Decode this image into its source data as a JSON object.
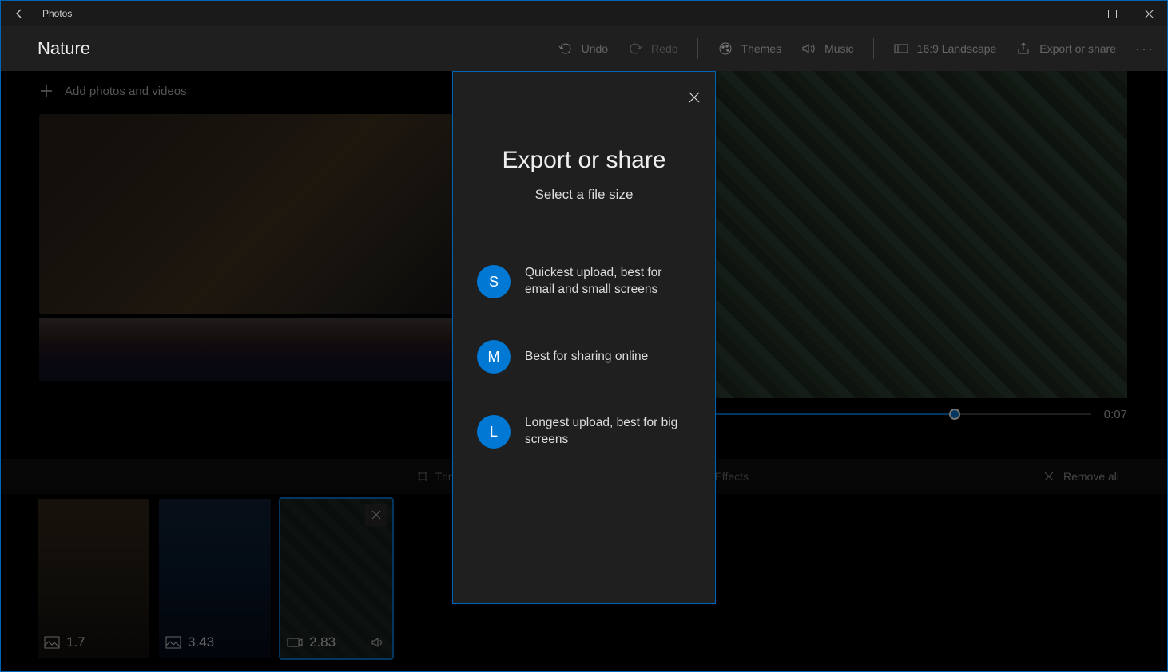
{
  "app": {
    "name": "Photos"
  },
  "project": {
    "title": "Nature"
  },
  "toolbar": {
    "undo": "Undo",
    "redo": "Redo",
    "themes": "Themes",
    "music": "Music",
    "aspect": "16:9 Landscape",
    "export": "Export or share"
  },
  "library": {
    "add_label": "Add photos and videos"
  },
  "preview": {
    "timecode": "0:07",
    "progress_pct": 75
  },
  "storyboard": {
    "trim": "Trim",
    "effects": "Effects",
    "remove_all": "Remove all"
  },
  "clips": [
    {
      "duration": "1.7",
      "type": "image"
    },
    {
      "duration": "3.43",
      "type": "image"
    },
    {
      "duration": "2.83",
      "type": "video",
      "selected": true,
      "has_audio": true
    }
  ],
  "dialog": {
    "title": "Export or share",
    "subtitle": "Select a file size",
    "options": [
      {
        "badge": "S",
        "text": "Quickest upload, best for email and small screens"
      },
      {
        "badge": "M",
        "text": "Best for sharing online"
      },
      {
        "badge": "L",
        "text": "Longest upload, best for big screens"
      }
    ]
  },
  "colors": {
    "accent": "#0078d4"
  }
}
